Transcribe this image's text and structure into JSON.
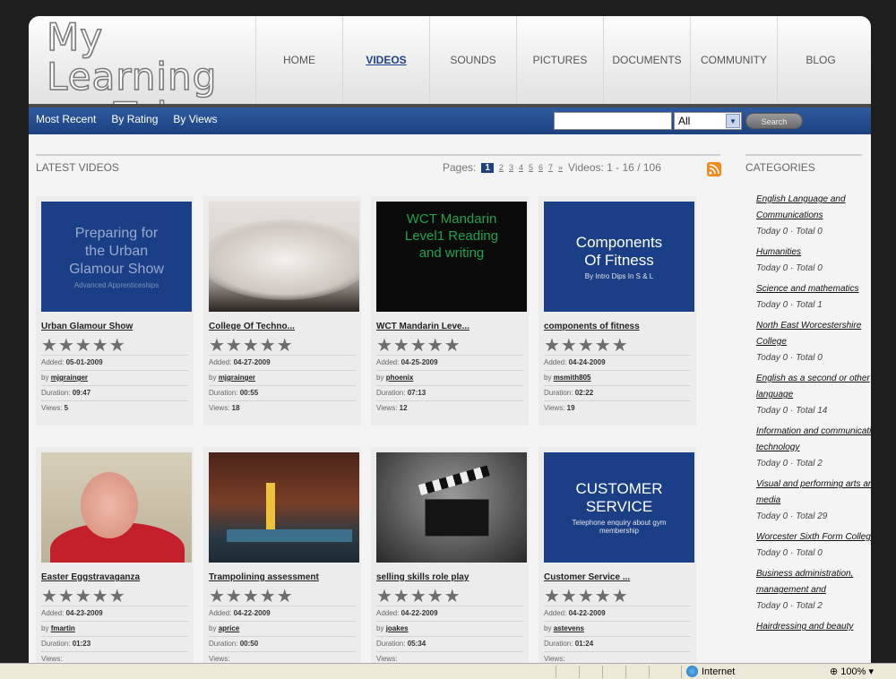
{
  "site": {
    "logo_line1": "My Learning",
    "logo_line2": "Tube"
  },
  "nav": [
    "HOME",
    "VIDEOS",
    "SOUNDS",
    "PICTURES",
    "DOCUMENTS",
    "COMMUNITY",
    "BLOG"
  ],
  "nav_active": "VIDEOS",
  "subnav": [
    "Most Recent",
    "By Rating",
    "By Views"
  ],
  "search": {
    "value": "",
    "select": "All",
    "button": "Search"
  },
  "section_title": "LATEST VIDEOS",
  "pager": {
    "label": "Pages:",
    "pages": [
      "1",
      "2",
      "3",
      "4",
      "5",
      "6",
      "7",
      "»"
    ],
    "current": "1",
    "count": "Videos: 1 - 16 / 106"
  },
  "videos": [
    {
      "title": "Urban Glamour Show",
      "added": "05-01-2009",
      "by": "mjgrainger",
      "duration": "09:47",
      "views": "5",
      "thumb_lines": [
        "Preparing for",
        "the Urban",
        "Glamour Show"
      ],
      "thumb_sub": "Advanced Apprenticeships",
      "thumb_kind": "blue-text"
    },
    {
      "title": "College Of Techno...",
      "added": "04-27-2009",
      "by": "mjgrainger",
      "duration": "00:55",
      "views": "18",
      "thumb_kind": "photo-blur"
    },
    {
      "title": "WCT Mandarin Leve...",
      "added": "04-25-2009",
      "by": "phoenix",
      "duration": "07:13",
      "views": "12",
      "thumb_lines": [
        "WCT Mandarin",
        "Level1 Reading",
        "and writing"
      ],
      "thumb_kind": "black-green"
    },
    {
      "title": "components of fitness",
      "added": "04-24-2009",
      "by": "msmith805",
      "duration": "02:22",
      "views": "19",
      "thumb_lines": [
        "Components",
        "Of Fitness"
      ],
      "thumb_sub": "By Intro Dips In S & L",
      "thumb_kind": "blue-white"
    },
    {
      "title": "Easter Eggstravaganza",
      "added": "04-23-2009",
      "by": "fmartin",
      "duration": "01:23",
      "views": "",
      "thumb_kind": "photo-person"
    },
    {
      "title": "Trampolining assessment",
      "added": "04-22-2009",
      "by": "aprice",
      "duration": "00:50",
      "views": "",
      "thumb_kind": "photo-gym"
    },
    {
      "title": "selling skills role play",
      "added": "04-22-2009",
      "by": "joakes",
      "duration": "05:34",
      "views": "",
      "thumb_kind": "clapper"
    },
    {
      "title": "Customer Service ...",
      "added": "04-22-2009",
      "by": "astevens",
      "duration": "01:24",
      "views": "",
      "thumb_lines": [
        "CUSTOMER",
        "SERVICE"
      ],
      "thumb_sub": "Telephone enquiry about gym membership",
      "thumb_kind": "blue-white"
    }
  ],
  "labels": {
    "added": "Added:",
    "by": "by",
    "duration": "Duration:",
    "views": "Views:"
  },
  "sidebar": {
    "title": "CATEGORIES",
    "categories": [
      {
        "name": "English Language and Communications",
        "stat": "Today 0 · Total 0"
      },
      {
        "name": "Humanities",
        "stat": "Today 0 · Total 0"
      },
      {
        "name": "Science and mathematics",
        "stat": "Today 0 · Total 1"
      },
      {
        "name": "North East Worcestershire College",
        "stat": "Today 0 · Total 0"
      },
      {
        "name": "English as a second or other language",
        "stat": "Today 0 · Total 14"
      },
      {
        "name": "Information and communication technology",
        "stat": "Today 0 · Total 2"
      },
      {
        "name": "Visual and performing arts and media",
        "stat": "Today 0 · Total 29"
      },
      {
        "name": "Worcester Sixth Form College",
        "stat": "Today 0 · Total 0"
      },
      {
        "name": "Business administration, management and",
        "stat": "Today 0 · Total 2"
      },
      {
        "name": "Hairdressing and beauty",
        "stat": ""
      }
    ]
  },
  "statusbar": {
    "zone": "Internet",
    "zoom": "100%"
  },
  "colors": {
    "nav_bar": "#1d4181",
    "thumb_blue": "#1a3f86",
    "rss": "#f28b1e"
  }
}
